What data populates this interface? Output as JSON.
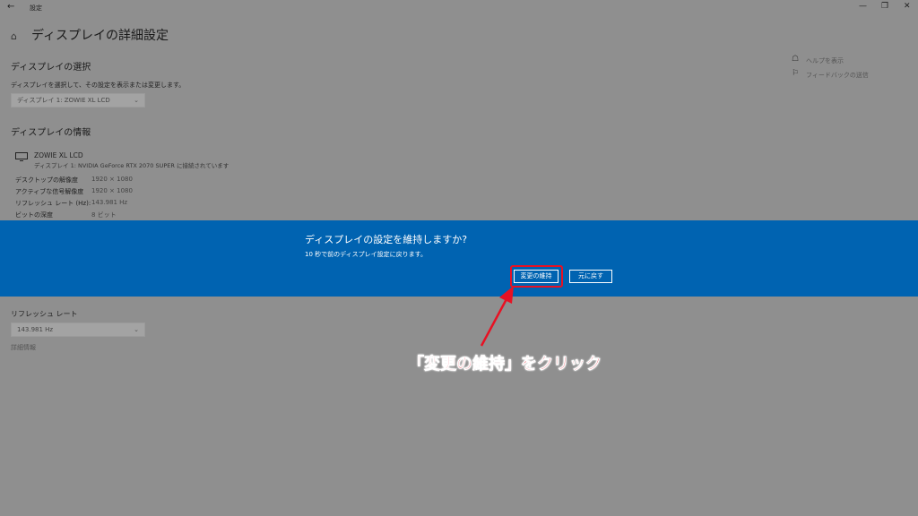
{
  "titlebar": {
    "back_glyph": "←",
    "app_title": "設定",
    "minimize_glyph": "—",
    "restore_glyph": "❐",
    "close_glyph": "✕"
  },
  "page": {
    "title": "ディスプレイの詳細設定",
    "home_glyph": "⌂"
  },
  "select_display": {
    "heading": "ディスプレイの選択",
    "description": "ディスプレイを選択して、その設定を表示または変更します。",
    "value": "ディスプレイ 1: ZOWIE XL LCD"
  },
  "display_info": {
    "heading": "ディスプレイの情報",
    "monitor_name": "ZOWIE XL LCD",
    "connection": "ディスプレイ 1: NVIDIA GeForce RTX 2070 SUPER に接続されています",
    "rows": [
      {
        "label": "デスクトップの解像度",
        "value": "1920 × 1080"
      },
      {
        "label": "アクティブな信号解像度",
        "value": "1920 × 1080"
      },
      {
        "label": "リフレッシュ レート (Hz):",
        "value": "143.981 Hz"
      },
      {
        "label": "ビットの深度",
        "value": "8 ビット"
      }
    ]
  },
  "refresh": {
    "heading": "リフレッシュ レート",
    "value": "143.981 Hz",
    "more_link": "詳細情報"
  },
  "side_links": {
    "help": "ヘルプを表示",
    "feedback": "フィードバックの送信"
  },
  "dialog": {
    "title": "ディスプレイの設定を維持しますか?",
    "subtitle": "10 秒で前のディスプレイ設定に戻ります。",
    "keep_label": "変更の維持",
    "revert_label": "元に戻す"
  },
  "annotation": {
    "text": "「変更の維持」をクリック",
    "color": "#e81123"
  },
  "colors": {
    "banner": "#0063b1",
    "overlay": "#8f8f8f"
  }
}
